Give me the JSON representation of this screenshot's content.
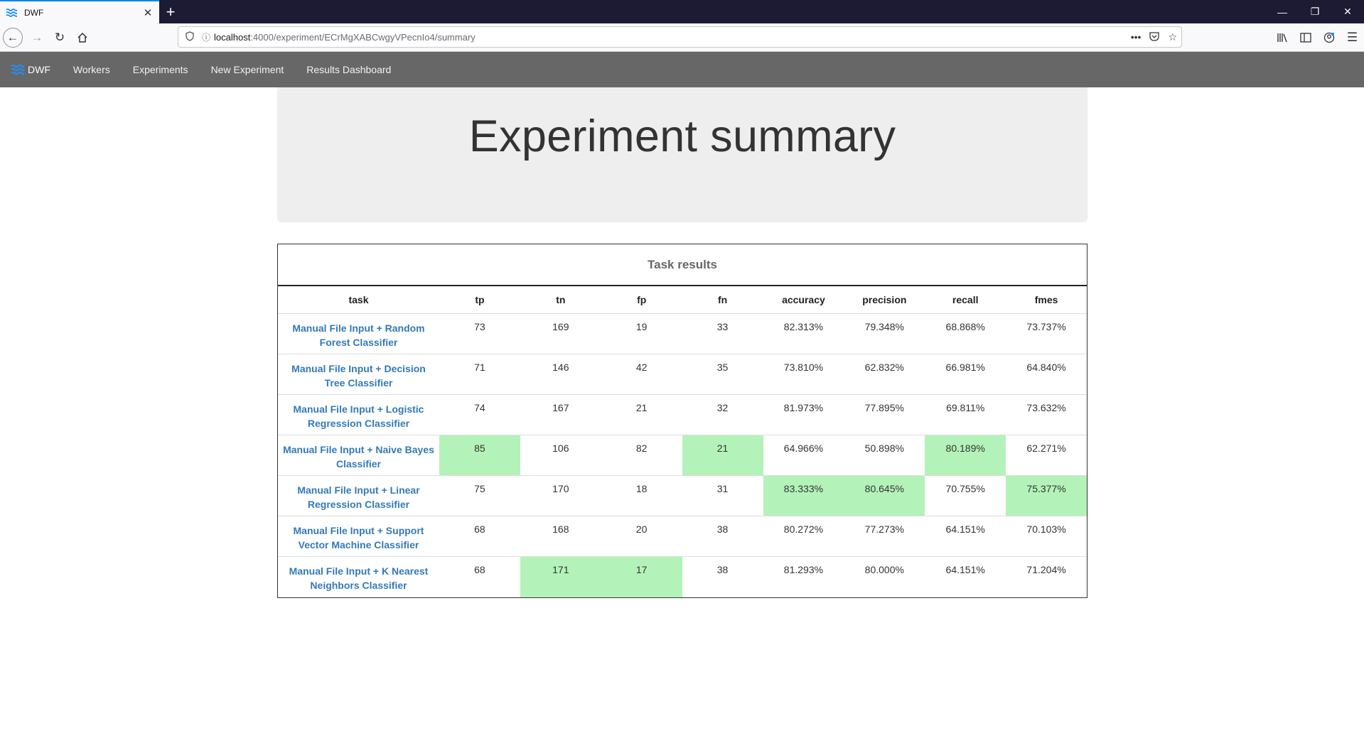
{
  "browser": {
    "tab_title": "DWF",
    "url_host": "localhost",
    "url_path": ":4000/experiment/ECrMgXABCwgyVPecnIo4/summary"
  },
  "appnav": {
    "brand": "DWF",
    "links": [
      "Workers",
      "Experiments",
      "New Experiment",
      "Results Dashboard"
    ]
  },
  "page": {
    "title": "Experiment summary"
  },
  "results": {
    "caption": "Task results",
    "columns": [
      "task",
      "tp",
      "tn",
      "fp",
      "fn",
      "accuracy",
      "precision",
      "recall",
      "fmes"
    ],
    "highlight_color": "#b3f3b9",
    "rows": [
      {
        "task": "Manual File Input + Random Forest Classifier",
        "cells": [
          "73",
          "169",
          "19",
          "33",
          "82.313%",
          "79.348%",
          "68.868%",
          "73.737%"
        ],
        "highlight": []
      },
      {
        "task": "Manual File Input + Decision Tree Classifier",
        "cells": [
          "71",
          "146",
          "42",
          "35",
          "73.810%",
          "62.832%",
          "66.981%",
          "64.840%"
        ],
        "highlight": []
      },
      {
        "task": "Manual File Input + Logistic Regression Classifier",
        "cells": [
          "74",
          "167",
          "21",
          "32",
          "81.973%",
          "77.895%",
          "69.811%",
          "73.632%"
        ],
        "highlight": []
      },
      {
        "task": "Manual File Input + Naive Bayes Classifier",
        "cells": [
          "85",
          "106",
          "82",
          "21",
          "64.966%",
          "50.898%",
          "80.189%",
          "62.271%"
        ],
        "highlight": [
          "tp",
          "fn",
          "recall"
        ]
      },
      {
        "task": "Manual File Input + Linear Regression Classifier",
        "cells": [
          "75",
          "170",
          "18",
          "31",
          "83.333%",
          "80.645%",
          "70.755%",
          "75.377%"
        ],
        "highlight": [
          "accuracy",
          "precision",
          "fmes"
        ]
      },
      {
        "task": "Manual File Input + Support Vector Machine Classifier",
        "cells": [
          "68",
          "168",
          "20",
          "38",
          "80.272%",
          "77.273%",
          "64.151%",
          "70.103%"
        ],
        "highlight": []
      },
      {
        "task": "Manual File Input + K Nearest Neighbors Classifier",
        "cells": [
          "68",
          "171",
          "17",
          "38",
          "81.293%",
          "80.000%",
          "64.151%",
          "71.204%"
        ],
        "highlight": [
          "tn",
          "fp"
        ]
      }
    ]
  }
}
